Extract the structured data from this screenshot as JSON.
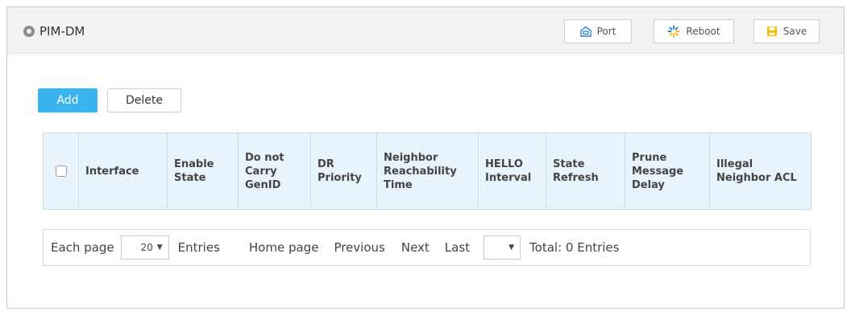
{
  "header": {
    "title": "PIM-DM",
    "buttons": {
      "port": "Port",
      "reboot": "Reboot",
      "save": "Save"
    }
  },
  "actions": {
    "add": "Add",
    "delete": "Delete"
  },
  "table": {
    "columns": [
      "Interface",
      "Enable State",
      "Do not Carry GenID",
      "DR Priority",
      "Neighbor Reachability Time",
      "HELLO Interval",
      "State Refresh",
      "Prune Message Delay",
      "Illegal Neighbor ACL"
    ],
    "rows": []
  },
  "pager": {
    "each_page": "Each page",
    "page_size": "20",
    "entries": "Entries",
    "home": "Home page",
    "previous": "Previous",
    "next": "Next",
    "last": "Last",
    "page_select": "",
    "total": "Total: 0 Entries"
  },
  "colors": {
    "accent": "#3bb3ee",
    "header_bg": "#f2f2f2",
    "table_header_bg": "#e8f3fb",
    "icon_blue": "#2a7fd4",
    "icon_yellow": "#f5b900"
  },
  "icons": {
    "title": "location-pin-icon",
    "port": "port-icon",
    "reboot": "reboot-icon",
    "save": "save-icon",
    "dropdown": "caret-down-icon"
  }
}
